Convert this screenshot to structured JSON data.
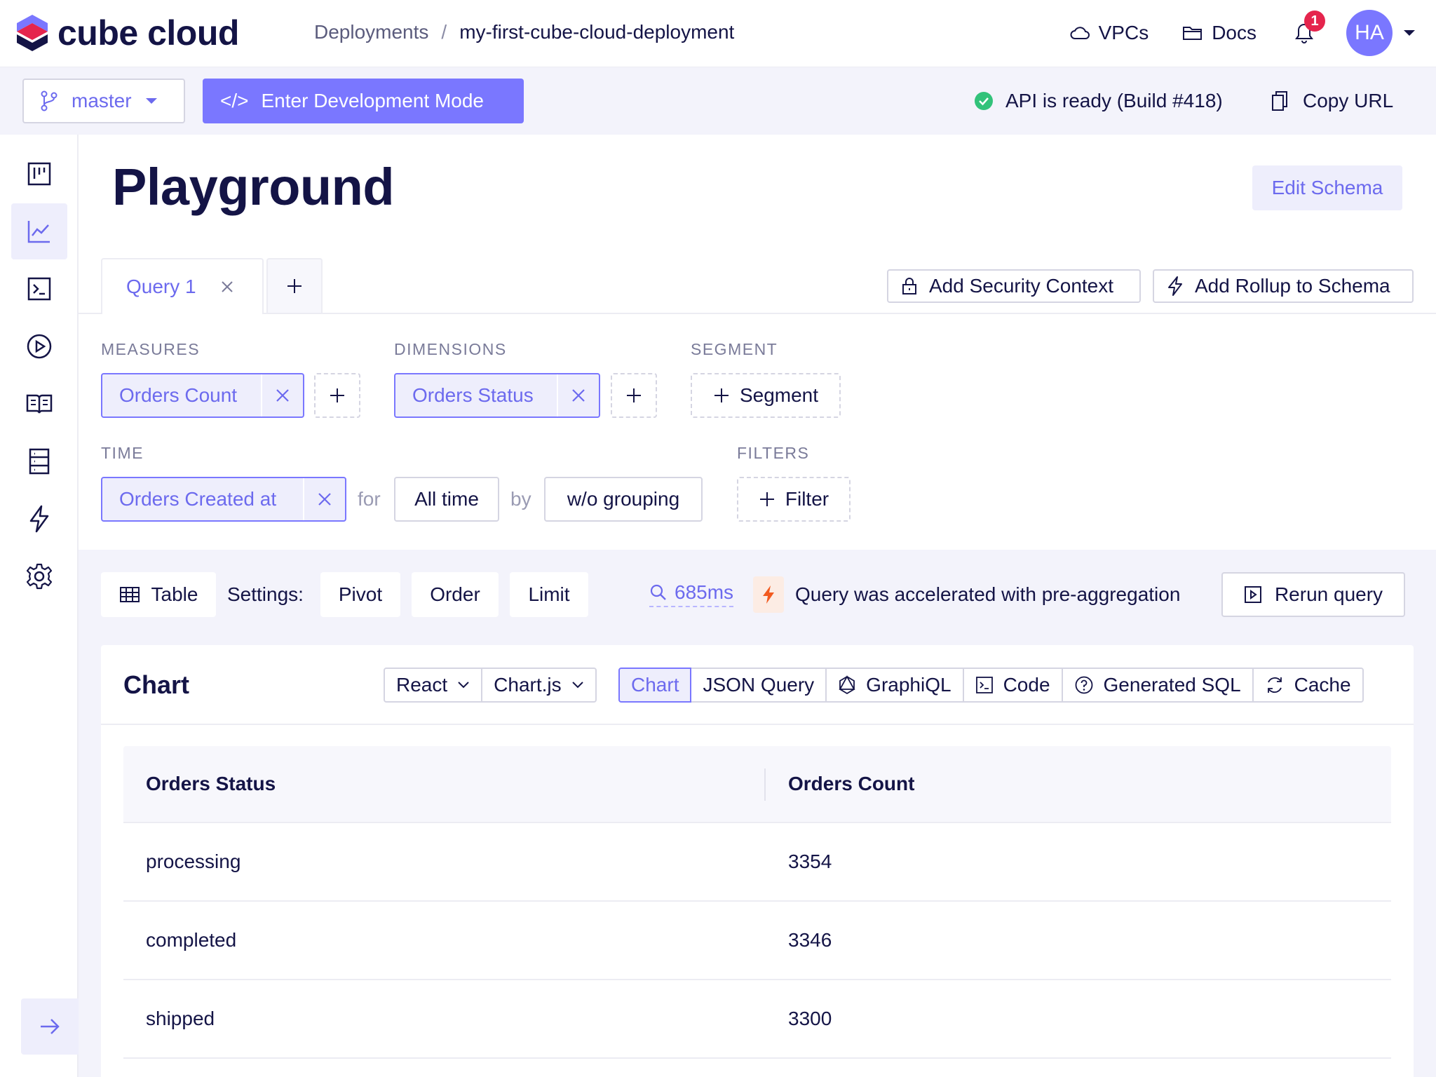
{
  "header": {
    "logo_text": "cube cloud",
    "breadcrumb": {
      "parent": "Deployments",
      "separator": "/",
      "current": "my-first-cube-cloud-deployment"
    },
    "vpcs_label": "VPCs",
    "docs_label": "Docs",
    "notification_count": "1",
    "avatar_initials": "HA"
  },
  "subbar": {
    "branch": "master",
    "dev_mode_label": "Enter Development Mode",
    "dev_mode_icon": "</>",
    "api_status": "API is ready (Build #418)",
    "copy_url_label": "Copy URL"
  },
  "sidebar": {
    "items": [
      "dashboard-icon",
      "chart-icon",
      "terminal-icon",
      "play-icon",
      "book-icon",
      "database-icon",
      "lightning-icon",
      "gear-icon"
    ],
    "active_index": 1
  },
  "page": {
    "title": "Playground",
    "edit_schema_label": "Edit Schema"
  },
  "query_tabs": {
    "tabs": [
      {
        "label": "Query 1"
      }
    ],
    "add_security_context": "Add Security Context",
    "add_rollup": "Add Rollup to Schema"
  },
  "builder": {
    "measures_label": "MEASURES",
    "measures": [
      "Orders Count"
    ],
    "dimensions_label": "DIMENSIONS",
    "dimensions": [
      "Orders Status"
    ],
    "segment_label": "SEGMENT",
    "segment_btn": "Segment",
    "time_label": "TIME",
    "time_member": "Orders Created at",
    "for_label": "for",
    "date_range": "All time",
    "by_label": "by",
    "granularity": "w/o grouping",
    "filters_label": "FILTERS",
    "filter_btn": "Filter"
  },
  "results_bar": {
    "view_label": "Table",
    "settings_label": "Settings:",
    "pivot": "Pivot",
    "order": "Order",
    "limit": "Limit",
    "timing": "685ms",
    "accel_message": "Query was accelerated with pre-aggregation",
    "rerun": "Rerun query"
  },
  "chart_card": {
    "title": "Chart",
    "framework": "React",
    "library": "Chart.js",
    "tabs": {
      "chart": "Chart",
      "json_query": "JSON Query",
      "graphiql": "GraphiQL",
      "code": "Code",
      "generated_sql": "Generated SQL",
      "cache": "Cache"
    },
    "active_tab": "chart"
  },
  "table": {
    "columns": [
      "Orders Status",
      "Orders Count"
    ],
    "rows": [
      [
        "processing",
        "3354"
      ],
      [
        "completed",
        "3346"
      ],
      [
        "shipped",
        "3300"
      ]
    ]
  },
  "colors": {
    "accent": "#7a77ff",
    "accent_text": "#6c6aee",
    "dark_text": "#141446",
    "success": "#32c27a",
    "badge": "#e5254d",
    "accel": "#f25a1f"
  }
}
